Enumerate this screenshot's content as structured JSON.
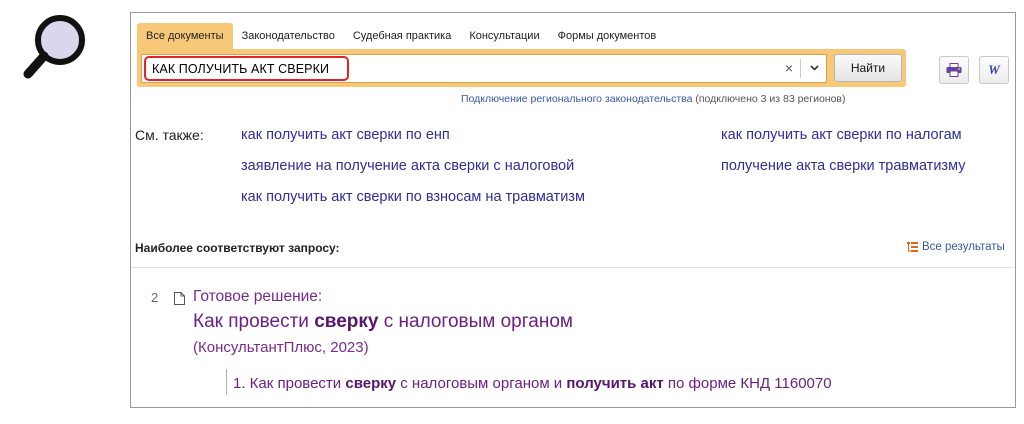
{
  "tabs": [
    {
      "label": "Все документы",
      "active": true
    },
    {
      "label": "Законодательство",
      "active": false
    },
    {
      "label": "Судебная практика",
      "active": false
    },
    {
      "label": "Консультации",
      "active": false
    },
    {
      "label": "Формы документов",
      "active": false
    }
  ],
  "search": {
    "value": "КАК ПОЛУЧИТЬ АКТ СВЕРКИ",
    "clear_glyph": "×",
    "history_glyph": "⌄",
    "find_label": "Найти"
  },
  "icons": {
    "magnifier": "magnifier-icon",
    "print": "printer-icon",
    "word": "word-export-icon",
    "all_results": "results-list-icon",
    "document": "document-icon"
  },
  "tools": {
    "word_glyph": "W"
  },
  "regional": {
    "link": "Подключение регионального законодательства",
    "status": "(подключено 3 из 83 регионов)"
  },
  "see_also": {
    "label": "См. также:",
    "links": [
      "как получить акт сверки по енп",
      "как получить акт сверки по налогам",
      "заявление на получение акта сверки с налоговой",
      "получение акта сверки травматизму",
      "как получить акт сверки по взносам на травматизм"
    ]
  },
  "results": {
    "header": "Наиболее соответствуют запросу:",
    "all_results": "Все результаты",
    "items": [
      {
        "number": "2",
        "type": "Готовое решение:",
        "title_pre": "Как провести ",
        "title_bold": "сверку",
        "title_post": " с налоговым органом",
        "source": "(КонсультантПлюс, 2023)",
        "sub_pre": "1. Как провести ",
        "sub_bold1": "сверку",
        "sub_mid": " с налоговым органом и ",
        "sub_bold2": "получить акт",
        "sub_post": " по форме КНД 1160070"
      }
    ]
  },
  "colors": {
    "accent_tab": "#f7c878",
    "highlight_border": "#e32227",
    "link": "#2f2e9a",
    "result_purple": "#6e1f86"
  }
}
